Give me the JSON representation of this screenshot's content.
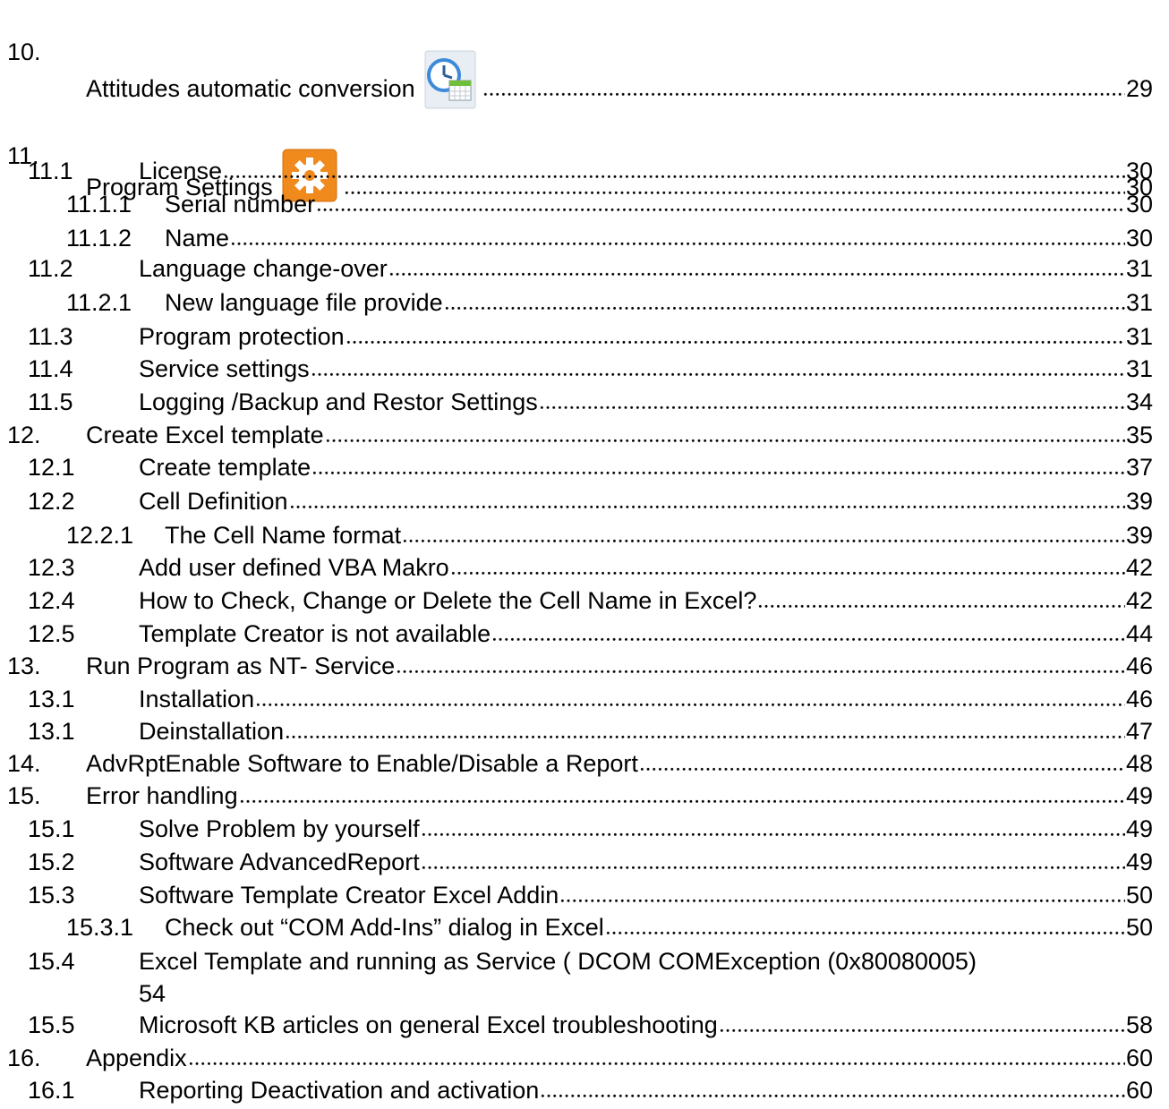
{
  "toc": [
    {
      "num": "10.",
      "title": "Attitudes automatic conversion",
      "icon": "clock-calendar-icon",
      "page": "29"
    },
    {
      "num": "11.",
      "title": "Program Settings",
      "icon": "gear-icon",
      "page": "30"
    },
    {
      "num": "11.1",
      "title": "License",
      "page": "30"
    },
    {
      "num": "11.1.1",
      "title": "Serial number",
      "page": "30"
    },
    {
      "num": "11.1.2",
      "title": "Name",
      "page": "30"
    },
    {
      "num": "11.2",
      "title": "Language change-over",
      "page": "31"
    },
    {
      "num": "11.2.1",
      "title": "New language file provide",
      "page": "31"
    },
    {
      "num": "11.3",
      "title": "Program protection",
      "page": "31"
    },
    {
      "num": "11.4",
      "title": "Service settings",
      "page": "31"
    },
    {
      "num": "11.5",
      "title": "Logging  /Backup and Restor Settings",
      "page": "34"
    },
    {
      "num": "12.",
      "title": "Create Excel template",
      "page": "35"
    },
    {
      "num": "12.1",
      "title": "Create template",
      "page": "37"
    },
    {
      "num": "12.2",
      "title": "Cell Definition",
      "page": "39"
    },
    {
      "num": "12.2.1",
      "title": "The Cell Name format",
      "page": "39"
    },
    {
      "num": "12.3",
      "title": "Add user defined VBA Makro",
      "page": "42"
    },
    {
      "num": "12.4",
      "title": "How to Check, Change or Delete the Cell Name in Excel?",
      "page": "42"
    },
    {
      "num": "12.5",
      "title": "Template Creator is not available",
      "page": "44"
    },
    {
      "num": "13.",
      "title": "Run Program as NT- Service",
      "page": "46"
    },
    {
      "num": "13.1",
      "title": "Installation",
      "page": "46"
    },
    {
      "num": "13.1",
      "title": "Deinstallation",
      "page": "47"
    },
    {
      "num": "14.",
      "title": "AdvRptEnable Software to Enable/Disable a Report",
      "page": "48"
    },
    {
      "num": "15.",
      "title": "Error handling",
      "page": "49"
    },
    {
      "num": "15.1",
      "title": "Solve Problem by yourself",
      "page": "49"
    },
    {
      "num": "15.2",
      "title": "Software AdvancedReport",
      "page": "49"
    },
    {
      "num": "15.3",
      "title": "Software Template Creator Excel Addin",
      "page": "50"
    },
    {
      "num": "15.3.1",
      "title": "Check out “COM Add-Ins” dialog in Excel",
      "page": "50"
    },
    {
      "num": "15.4",
      "title": "Excel Template and running as Service ( DCOM COMException (0x80080005)",
      "page": "54"
    },
    {
      "num": "15.5",
      "title": "Microsoft KB articles on general Excel troubleshooting",
      "page": "58"
    },
    {
      "num": "16.",
      "title": "Appendix",
      "page": "60"
    },
    {
      "num": "16.1",
      "title": "Reporting Deactivation and activation",
      "page": "60"
    }
  ]
}
